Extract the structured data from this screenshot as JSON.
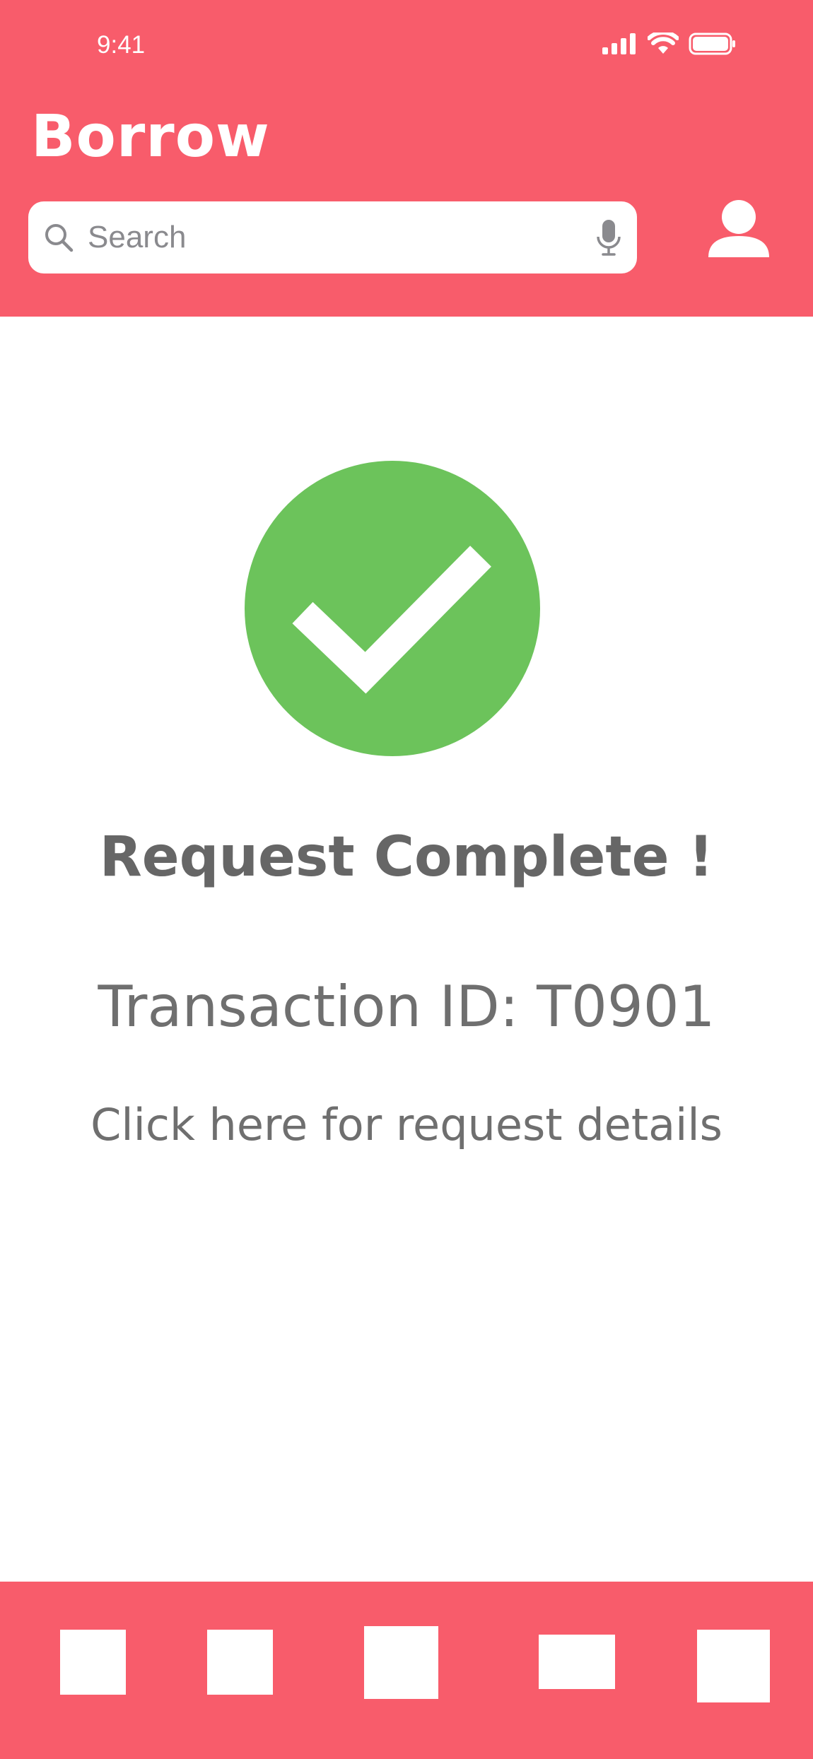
{
  "status_bar": {
    "time": "9:41"
  },
  "header": {
    "title": "Borrow",
    "search": {
      "placeholder": "Search",
      "value": ""
    }
  },
  "confirmation": {
    "headline": "Request Complete !",
    "transaction": "Transaction ID: T0901",
    "details_link": "Click here for request details"
  },
  "colors": {
    "brand": "#f85c6b",
    "success": "#6cc35b",
    "text": "#6f6f6f"
  },
  "icons": {
    "search": "search-icon",
    "mic": "microphone-icon",
    "profile": "person-icon",
    "success": "checkmark-icon"
  }
}
